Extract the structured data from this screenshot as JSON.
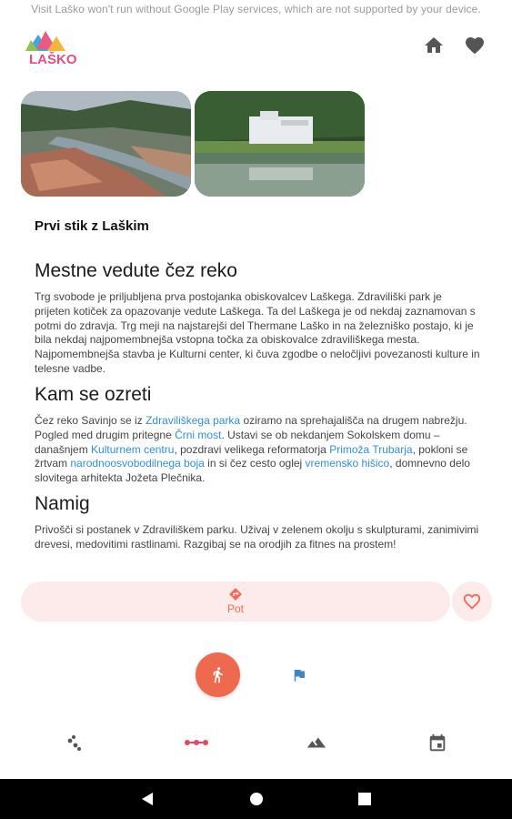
{
  "toast": "Visit Laško won't run without Google Play services, which are not supported by your device.",
  "header": {
    "logo_text": "LAŠKO",
    "icons": [
      "home-icon",
      "heart-icon"
    ]
  },
  "subtitle": "Prvi stik z Laškim",
  "sections": {
    "s1": {
      "heading": "Mestne vedute čez reko",
      "body": "Trg svobode je priljubljena prva postojanka obiskovalcev Laškega. Zdraviliški park je prijeten kotiček za opazovanje vedute Laškega. Ta del Laškega je od nekdaj zaznamovan s potmi do zdravja. Trg meji na najstarejši del Thermane Laško in na železniško postajo, ki je bila nekdaj najpomembnejša vstopna točka za obiskovalce zdraviliškega mesta. Najpomembnejša stavba je Kulturni center, ki čuva zgodbe o neločljivi povezanosti kulture in telesne vadbe."
    },
    "s2": {
      "heading": "Kam se ozreti",
      "t1": "Čez reko Savinjo se iz ",
      "l1": "Zdraviliškega parka",
      "t2": " oziramo na sprehajališča na drugem nabrežju. Pogled med drugim pritegne ",
      "l2": "Črni most",
      "t3": ". Ustavi se ob nekdanjem Sokolskem domu – današnjem ",
      "l3": "Kulturnem centru",
      "t4": ", pozdravi velikega reformatorja ",
      "l4": "Primoža Trubarja",
      "t5": ", pokloni se žrtvam ",
      "l5": "narodnoosvobodilnega boja",
      "t6": " in si čez cesto oglej ",
      "l6": "vremensko hišico",
      "t7": ", domnevno delo slovitega arhitekta Jožeta Plečnika."
    },
    "s3": {
      "heading": "Namig",
      "body": "Privošči si postanek v Zdraviliškem parku. Uživaj v zelenem okolju s  skulpturami, zanimivimi drevesi, medovitimi rastlinami. Razgibaj se na orodjih za fitnes na prostem!"
    }
  },
  "actions": {
    "pot_label": "Pot",
    "pot_icon": "directions-icon",
    "favorite_icon": "heart-outline-icon"
  },
  "fab_icon": "hiker-icon",
  "flag_icon": "flag-icon",
  "bottom_nav": [
    "points-icon",
    "route-dots-icon",
    "mountains-icon",
    "calendar-icon"
  ],
  "colors": {
    "accent": "#ee6a4e",
    "link": "#2f8fd8",
    "pill_bg": "#fdeaea"
  }
}
